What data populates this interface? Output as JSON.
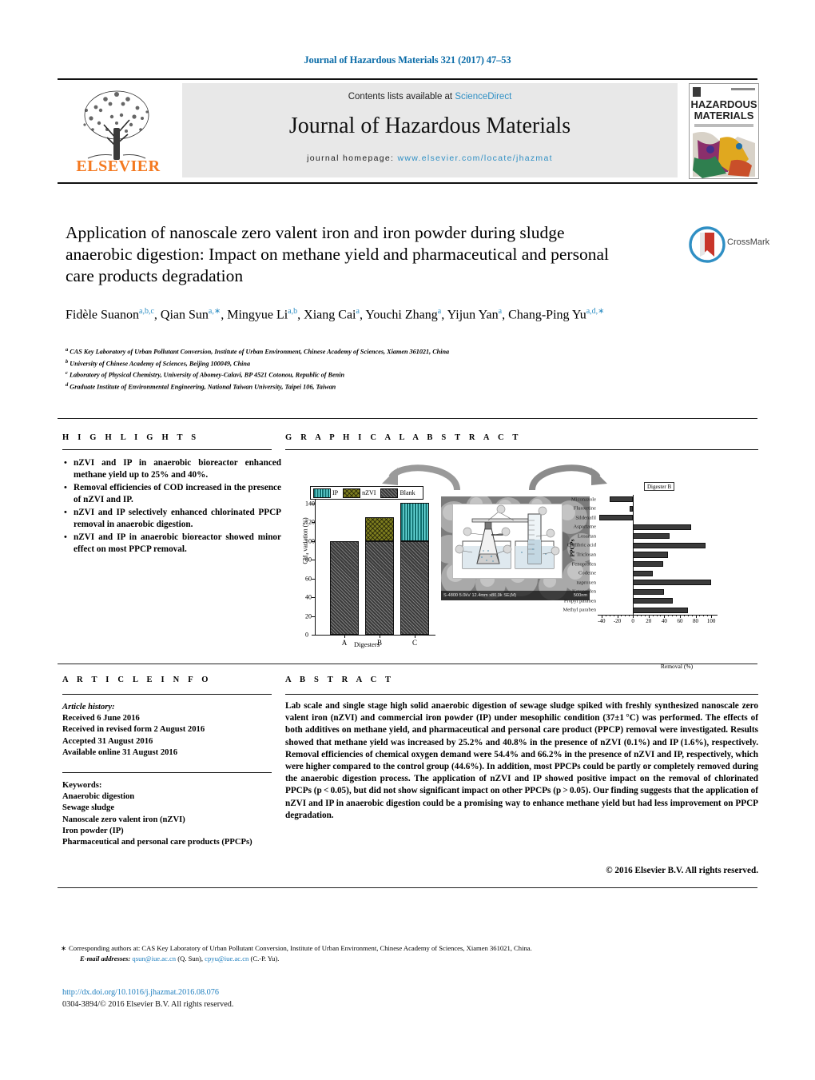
{
  "journal_ref": "Journal of Hazardous Materials 321 (2017) 47–53",
  "masthead": {
    "contents_prefix": "Contents lists available at ",
    "sciencedirect": "ScienceDirect",
    "journal_title": "Journal of Hazardous Materials",
    "homepage_prefix": "journal homepage: ",
    "homepage_url": "www.elsevier.com/locate/jhazmat",
    "publisher": "ELSEVIER",
    "publisher_color": "#F47920",
    "link_color": "#2f8fc4",
    "cover_title_line1": "HAZARDOUS",
    "cover_title_line2": "MATERIALS"
  },
  "article": {
    "title": "Application of nanoscale zero valent iron and iron powder during sludge anaerobic digestion: Impact on methane yield and pharmaceutical and personal care products degradation",
    "authors": [
      {
        "name": "Fidèle Suanon",
        "sup": "a,b,c"
      },
      {
        "name": "Qian Sun",
        "sup": "a,∗"
      },
      {
        "name": "Mingyue Li",
        "sup": "a,b"
      },
      {
        "name": "Xiang Cai",
        "sup": "a"
      },
      {
        "name": "Youchi Zhang",
        "sup": "a"
      },
      {
        "name": "Yijun Yan",
        "sup": "a"
      },
      {
        "name": "Chang-Ping Yu",
        "sup": "a,d,∗"
      }
    ],
    "affiliations": [
      {
        "key": "a",
        "text": "CAS Key Laboratory of Urban Pollutant Conversion, Institute of Urban Environment, Chinese Academy of Sciences, Xiamen 361021, China"
      },
      {
        "key": "b",
        "text": "University of Chinese Academy of Sciences, Beijing 100049, China"
      },
      {
        "key": "c",
        "text": "Laboratory of Physical Chemistry, University of Abomey-Calavi, BP 4521 Cotonou, Republic of Benin"
      },
      {
        "key": "d",
        "text": "Graduate Institute of Environmental Engineering, National Taiwan University, Taipei 106, Taiwan"
      }
    ],
    "crossmark_label": "CrossMark"
  },
  "sections": {
    "highlights": "H I G H L I G H T S",
    "graphical_abstract": "G R A P H I C A L   A B S T R A C T",
    "article_info": "A R T I C L E   I N F O",
    "abstract": "A B S T R A C T"
  },
  "highlights": [
    "nZVI and IP in anaerobic bioreactor enhanced methane yield up to 25% and 40%.",
    "Removal efficiencies of COD increased in the presence of nZVI and IP.",
    "nZVI and IP selectively enhanced chlorinated PPCP removal in anaerobic digestion.",
    "nZVI and IP in anaerobic bioreactor showed minor effect on most PPCP removal."
  ],
  "article_info": {
    "history_label": "Article history:",
    "history": [
      "Received 6 June 2016",
      "Received in revised form 2 August 2016",
      "Accepted 31 August 2016",
      "Available online 31 August 2016"
    ],
    "keywords_label": "Keywords:",
    "keywords": [
      "Anaerobic digestion",
      "Sewage sludge",
      "Nanoscale zero valent iron (nZVI)",
      "Iron powder (IP)",
      "Pharmaceutical and personal care products (PPCPs)"
    ]
  },
  "abstract_text": "Lab scale and single stage high solid anaerobic digestion of sewage sludge spiked with freshly synthesized nanoscale zero valent iron (nZVI) and commercial iron powder (IP) under mesophilic condition (37±1 °C) was performed. The effects of both additives on methane yield, and pharmaceutical and personal care product (PPCP) removal were investigated. Results showed that methane yield was increased by 25.2% and 40.8% in the presence of nZVI (0.1%) and IP (1.6%), respectively. Removal efficiencies of chemical oxygen demand were 54.4% and 66.2% in the presence of nZVI and IP, respectively, which were higher compared to the control group (44.6%). In addition, most PPCPs could be partly or completely removed during the anaerobic digestion process. The application of nZVI and IP showed positive impact on the removal of chlorinated PPCPs (p < 0.05), but did not show significant impact on other PPCPs (p > 0.05). Our finding suggests that the application of nZVI and IP in anaerobic digestion could be a promising way to enhance methane yield but had less improvement on PPCP degradation.",
  "abstract_copyright": "© 2016 Elsevier B.V. All rights reserved.",
  "footnotes": {
    "corresponding": "Corresponding authors at: CAS Key Laboratory of Urban Pollutant Conversion, Institute of Urban Environment, Chinese Academy of Sciences, Xiamen 361021, China.",
    "email_label": "E-mail addresses:",
    "email1": "qsun@iue.ac.cn",
    "email1_who": "(Q. Sun),",
    "email2": "cpyu@iue.ac.cn",
    "email2_who": "(C.-P. Yu).",
    "doi": "http://dx.doi.org/10.1016/j.jhazmat.2016.08.076",
    "issn": "0304-3894/© 2016 Elsevier B.V. All rights reserved."
  },
  "chart_data": [
    {
      "type": "bar",
      "id": "methane-yield-bar-chart",
      "title": "",
      "xlabel": "Digesters",
      "ylabel": "CH₄ variation (%)",
      "categories": [
        "A",
        "B",
        "C"
      ],
      "ylim": [
        0,
        145
      ],
      "yticks": [
        0,
        20,
        40,
        60,
        80,
        100,
        120,
        140
      ],
      "grid": false,
      "legend": [
        "IP",
        "nZVI",
        "Blank"
      ],
      "legend_position": "top-left-inside",
      "colors": {
        "IP": "#0f6d6d",
        "nZVI": "#7d7d1e",
        "Blank": "#3b3b3b"
      },
      "stacks": [
        {
          "category": "A",
          "base_series": "Blank",
          "base": 100,
          "top_series": null,
          "top": 0,
          "total": 100
        },
        {
          "category": "B",
          "base_series": "Blank",
          "base": 100,
          "top_series": "nZVI",
          "top": 25,
          "total": 125
        },
        {
          "category": "C",
          "base_series": "Blank",
          "base": 100,
          "top_series": "IP",
          "top": 41,
          "total": 141
        }
      ]
    },
    {
      "type": "bar",
      "id": "ppcp-removal-bar-chart",
      "orientation": "horizontal",
      "title": "Digester B",
      "xlabel": "Removal (%)",
      "ylabel": "PPCPs",
      "xlim": [
        -45,
        108
      ],
      "xticks": [
        -40,
        -20,
        0,
        20,
        40,
        60,
        80,
        100
      ],
      "grid": false,
      "bar_color": "#3b3b3b",
      "categories": [
        "Miconazole",
        "Fluoxetine",
        "Sildenafil",
        "Aspartame",
        "Losartan",
        "Clofibric acid",
        "Triclosan",
        "Fenoprofen",
        "Codeine",
        "naproxen",
        "Ketoprofen",
        "Propyl paraben",
        "Methyl paraben"
      ],
      "values": [
        -30,
        -4,
        -43,
        74,
        47,
        93,
        45,
        39,
        25,
        100,
        40,
        51,
        70
      ]
    }
  ],
  "sem_image": {
    "caption_left": "S-4800 5.0kV 12.4mm x80.0k SE(M)",
    "caption_right": "500nm"
  }
}
